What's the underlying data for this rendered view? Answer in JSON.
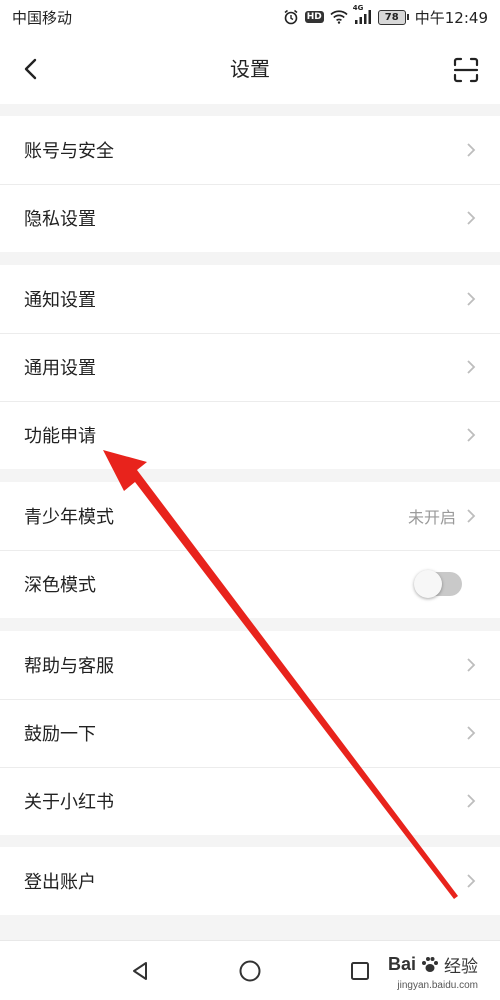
{
  "status_bar": {
    "carrier": "中国移动",
    "hd_badge": "HD",
    "network": "4G",
    "battery_level": "78",
    "time": "中午12:49",
    "icons": [
      "alarm-icon",
      "hd-icon",
      "wifi-icon",
      "signal-icon",
      "battery-icon"
    ]
  },
  "header": {
    "title": "设置",
    "back_icon": "chevron-left-icon",
    "scan_icon": "scan-icon"
  },
  "groups": [
    {
      "items": [
        {
          "label": "账号与安全"
        },
        {
          "label": "隐私设置"
        }
      ]
    },
    {
      "items": [
        {
          "label": "通知设置"
        },
        {
          "label": "通用设置"
        },
        {
          "label": "功能申请"
        }
      ]
    },
    {
      "items": [
        {
          "label": "青少年模式",
          "value": "未开启"
        },
        {
          "label": "深色模式",
          "toggle_on": false
        }
      ]
    },
    {
      "items": [
        {
          "label": "帮助与客服"
        },
        {
          "label": "鼓励一下"
        },
        {
          "label": "关于小红书"
        }
      ]
    },
    {
      "items": [
        {
          "label": "登出账户"
        }
      ]
    }
  ],
  "nav_bar": {
    "icons": [
      "back-triangle-icon",
      "home-circle-icon",
      "recents-square-icon"
    ]
  },
  "watermark": {
    "logo": "Bai",
    "text": "经验",
    "url": "jingyan.baidu.com"
  },
  "colors": {
    "annotation_arrow": "#e8231c",
    "background": "#f4f4f4",
    "toggle_off": "#c9c9c9"
  }
}
